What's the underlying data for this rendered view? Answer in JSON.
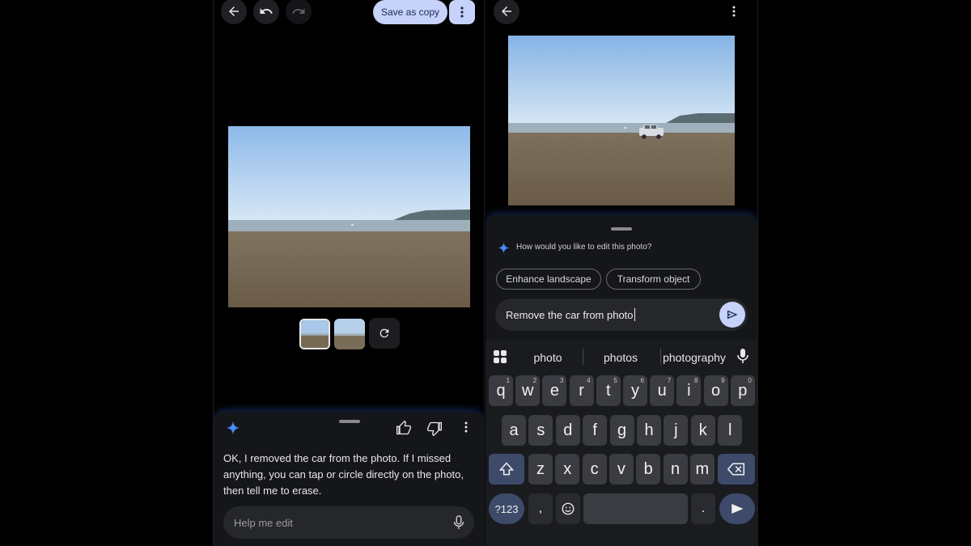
{
  "left_screen": {
    "header": {
      "save_label": "Save as copy"
    },
    "response": "OK, I removed the car from the photo. If I missed anything, you can tap or circle directly on the photo, then tell me to erase.",
    "input_placeholder": "Help me edit"
  },
  "right_screen": {
    "prompt": "How would you like to edit this photo?",
    "chips": [
      "Enhance landscape",
      "Transform object"
    ],
    "input_value": "Remove the car from photo",
    "keyboard": {
      "suggestions": [
        "photo",
        "photos",
        "photography"
      ],
      "row1": [
        {
          "k": "q",
          "n": "1"
        },
        {
          "k": "w",
          "n": "2"
        },
        {
          "k": "e",
          "n": "3"
        },
        {
          "k": "r",
          "n": "4"
        },
        {
          "k": "t",
          "n": "5"
        },
        {
          "k": "y",
          "n": "6"
        },
        {
          "k": "u",
          "n": "7"
        },
        {
          "k": "i",
          "n": "8"
        },
        {
          "k": "o",
          "n": "9"
        },
        {
          "k": "p",
          "n": "0"
        }
      ],
      "row2": [
        "a",
        "s",
        "d",
        "f",
        "g",
        "h",
        "j",
        "k",
        "l"
      ],
      "row3": [
        "z",
        "x",
        "c",
        "v",
        "b",
        "n",
        "m"
      ],
      "sym_label": "?123",
      "comma": ",",
      "period": "."
    }
  },
  "colors": {
    "accent": "#c7d2fa",
    "gemini": "#4a8cff",
    "background": "#000000"
  }
}
